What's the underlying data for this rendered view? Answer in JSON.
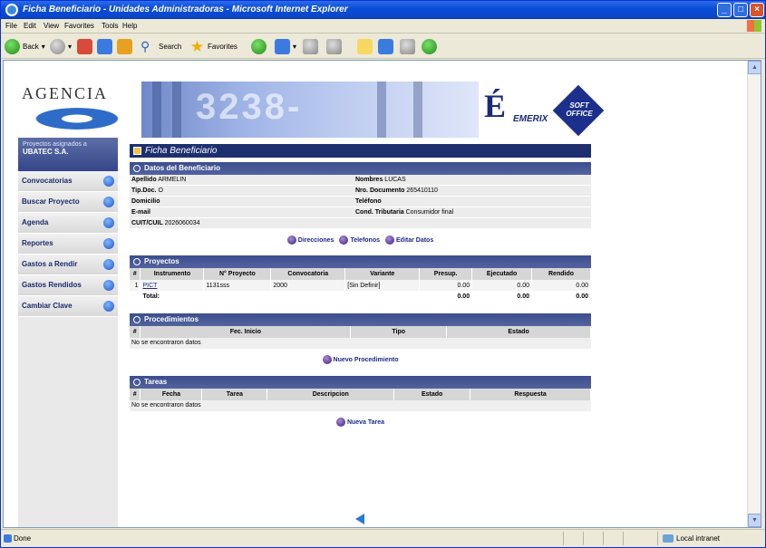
{
  "window": {
    "title": "Ficha Beneficiario - Unidades Administradoras - Microsoft Internet Explorer",
    "min": "_",
    "max": "□",
    "close": "×"
  },
  "menu": [
    "File",
    "Edit",
    "View",
    "Favorites",
    "Tools",
    "Help"
  ],
  "toolbar": {
    "back": "Back",
    "search": "Search",
    "favorites": "Favorites"
  },
  "banner": {
    "agencia": "AGENCIA",
    "photo_number": "3238-",
    "emerix_letter": "É",
    "emerix": "EMERIX",
    "soft_office": "SOFT OFFICE"
  },
  "project_box": {
    "label": "Proyectos asignados a",
    "name": "UBATEC S.A."
  },
  "nav": [
    "Convocatorias",
    "Buscar Proyecto",
    "Agenda",
    "Reportes",
    "Gastos a Rendir",
    "Gastos Rendidos",
    "Cambiar Clave"
  ],
  "page": {
    "title": "Ficha Beneficiario"
  },
  "beneficiario": {
    "header": "Datos del Beneficiario",
    "fields": [
      {
        "label": "Apellido",
        "value": "ARMELIN"
      },
      {
        "label": "Nombres",
        "value": "LUCAS"
      },
      {
        "label": "Tip.Doc.",
        "value": "O"
      },
      {
        "label": "Nro. Documento",
        "value": "265410110"
      },
      {
        "label": "Domicilio",
        "value": ""
      },
      {
        "label": "Teléfono",
        "value": ""
      },
      {
        "label": "E-mail",
        "value": ""
      },
      {
        "label": "Cond. Tributaria",
        "value": "Consumidor final"
      },
      {
        "label": "CUIT/CUIL",
        "value": "2026060034"
      },
      {
        "label": "",
        "value": ""
      }
    ],
    "actions": [
      "Direcciones",
      "Telefonos",
      "Editar Datos"
    ]
  },
  "proyectos": {
    "header": "Proyectos",
    "columns": [
      "#",
      "Instrumento",
      "N° Proyecto",
      "Convocatoria",
      "Variante",
      "Presup.",
      "Ejecutado",
      "Rendido"
    ],
    "rows": [
      {
        "n": "1",
        "instrumento": "PICT",
        "proyecto": "1131sss",
        "convocatoria": "2000",
        "variante": "[Sin Definir]",
        "presup": "0.00",
        "ejecutado": "0.00",
        "rendido": "0.00"
      }
    ],
    "total": {
      "label": "Total:",
      "presup": "0.00",
      "ejecutado": "0.00",
      "rendido": "0.00"
    }
  },
  "procedimientos": {
    "header": "Procedimientos",
    "columns": [
      "#",
      "Fec. Inicio",
      "Tipo",
      "Estado"
    ],
    "empty": "No se encontraron datos",
    "action": "Nuevo Procedimiento"
  },
  "tareas": {
    "header": "Tareas",
    "columns": [
      "#",
      "Fecha",
      "Tarea",
      "Descripcion",
      "Estado",
      "Respuesta"
    ],
    "empty": "No se encontraron datos",
    "action": "Nueva Tarea"
  },
  "status": {
    "text": "Done",
    "zone": "Local intranet"
  }
}
